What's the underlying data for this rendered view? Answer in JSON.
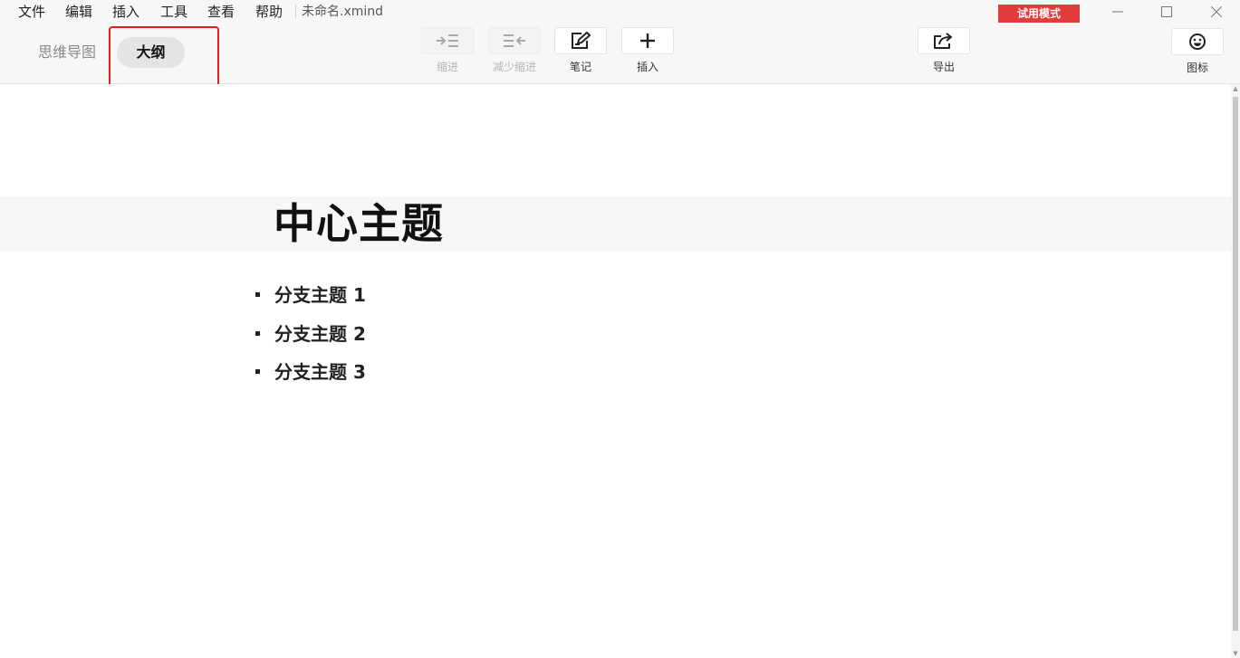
{
  "menu": {
    "items": [
      "文件",
      "编辑",
      "插入",
      "工具",
      "查看",
      "帮助"
    ],
    "file_title": "未命名.xmind",
    "trial_badge": "试用模式"
  },
  "view_switcher": {
    "mindmap": "思维导图",
    "outline": "大纲",
    "active": "outline"
  },
  "toolbar": {
    "indent": "缩进",
    "outdent": "减少缩进",
    "note": "笔记",
    "insert": "插入",
    "export": "导出",
    "icons": "图标"
  },
  "outline": {
    "central_topic": "中心主题",
    "branches": [
      "分支主题 1",
      "分支主题 2",
      "分支主题 3"
    ]
  },
  "colors": {
    "trial_badge": "#e23b3b",
    "highlight": "#e02020",
    "toolbar_bg": "#f7f7f7"
  }
}
